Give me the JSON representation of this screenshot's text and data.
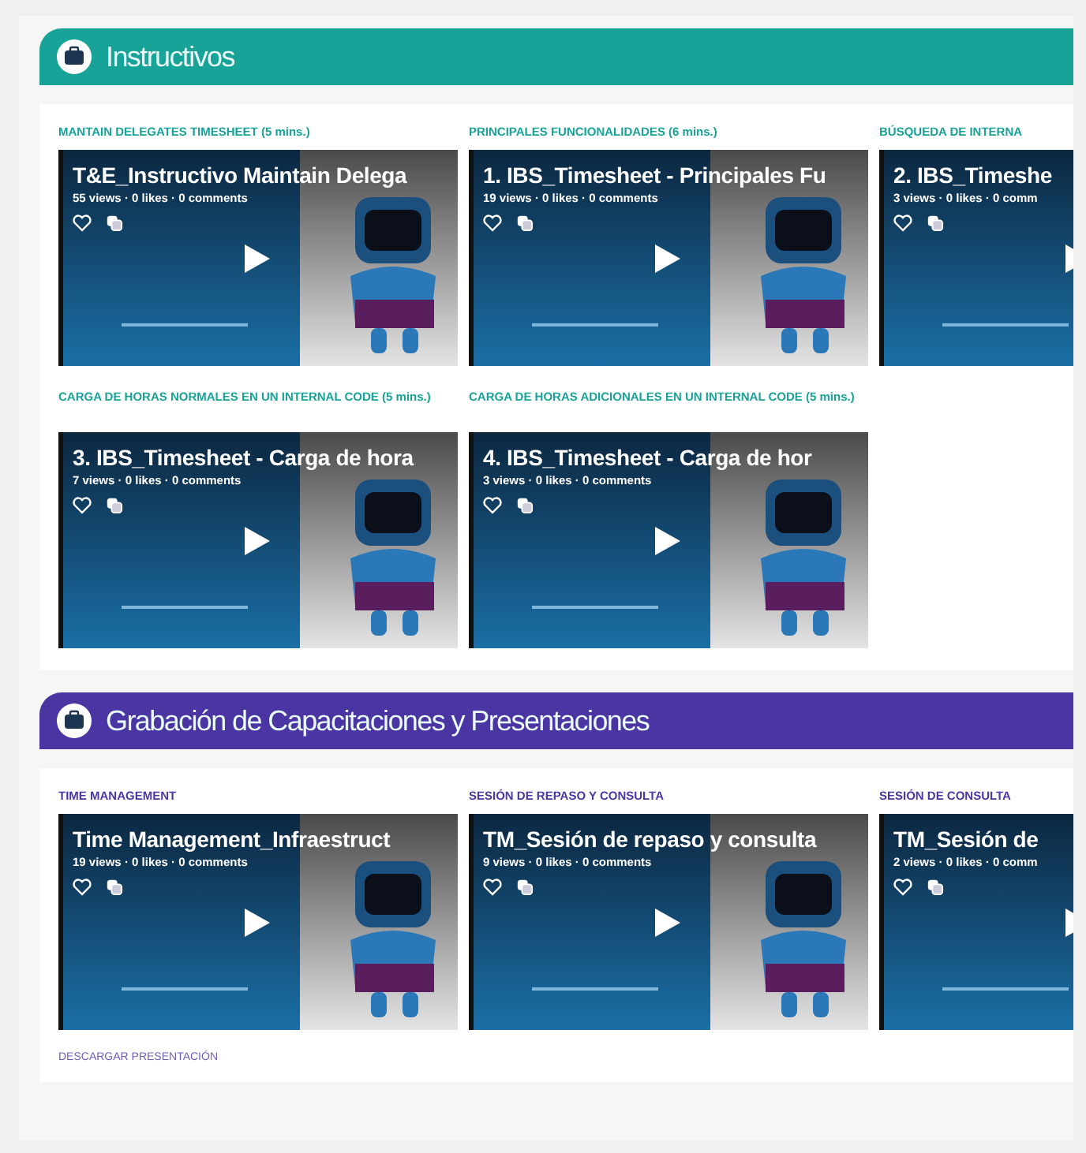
{
  "sections": [
    {
      "title": "Instructivos",
      "color": "#17a398",
      "rows": [
        [
          {
            "label": "MANTAIN DELEGATES TIMESHEET (5 mins.)",
            "title": "T&E_Instructivo Maintain Delega",
            "stats": "55 views · 0 likes · 0 comments"
          },
          {
            "label": "PRINCIPALES FUNCIONALIDADES (6 mins.)",
            "title": "1. IBS_Timesheet - Principales Fu",
            "stats": "19 views · 0 likes · 0 comments"
          },
          {
            "label": "BÚSQUEDA DE INTERNA",
            "title": "2. IBS_Timeshe",
            "stats": "3 views · 0 likes · 0 comm"
          }
        ],
        [
          {
            "label": "**CARGA DE HORAS NORMALES EN UN INTERNAL CODE** (5 mins.)",
            "title": "3. IBS_Timesheet - Carga de hora",
            "stats": "7 views · 0 likes · 0 comments"
          },
          {
            "label": "**CARGA DE HORAS ADICIONALES EN UN INTERNAL CODE** (5 mins.)",
            "title": "4. IBS_Timesheet - Carga de hor",
            "stats": "3 views · 0 likes · 0 comments"
          }
        ]
      ]
    },
    {
      "title": "Grabación de Capacitaciones y Presentaciones",
      "color": "#4b35a3",
      "rows": [
        [
          {
            "label": "TIME MANAGEMENT",
            "title": "Time Management_Infraestruct",
            "stats": "19 views · 0 likes · 0 comments"
          },
          {
            "label": "SESIÓN DE REPASO Y CONSULTA",
            "title": "TM_Sesión de repaso y consulta",
            "stats": "9 views · 0 likes · 0 comments"
          },
          {
            "label": "SESIÓN DE CONSULTA",
            "title": "TM_Sesión de",
            "stats": "2 views · 0 likes · 0 comm"
          }
        ]
      ],
      "link": "DESCARGAR PRESENTACIÓN"
    }
  ]
}
